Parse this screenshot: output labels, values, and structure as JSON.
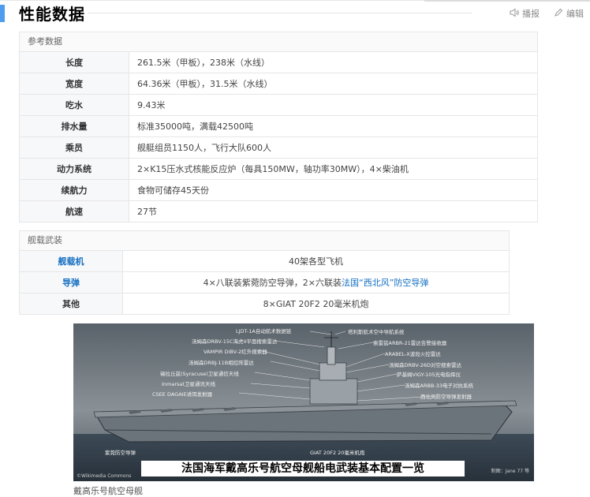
{
  "header": {
    "title": "性能数据",
    "actions": {
      "report": "播报",
      "edit": "编辑"
    }
  },
  "specs": {
    "caption": "参考数据",
    "rows": [
      {
        "key": "长度",
        "value": "261.5米（甲板），238米（水线）"
      },
      {
        "key": "宽度",
        "value": "64.36米（甲板），31.5米（水线）"
      },
      {
        "key": "吃水",
        "value": "9.43米"
      },
      {
        "key": "排水量",
        "value": "标准35000吨，满载42500吨"
      },
      {
        "key": "乘员",
        "value": "舰艇组员1150人，飞行大队600人"
      },
      {
        "key": "动力系统",
        "value": "2×K15压水式核能反应炉（每具150MW，轴功率30MW），4×柴油机"
      },
      {
        "key": "续航力",
        "value": "食物可储存45天份"
      },
      {
        "key": "航速",
        "value": "27节"
      }
    ]
  },
  "weapons": {
    "caption": "舰载武装",
    "rows": [
      {
        "key": "舰载机",
        "value": "40架各型飞机"
      },
      {
        "key": "导弹",
        "value_prefix": "4×八联装紫菀防空导弹，2×六联装",
        "value_link": "法国“西北风”防空导弹",
        "value_suffix": ""
      },
      {
        "key": "其他",
        "value": "8×GIAT 20F2 20毫米机炮"
      }
    ]
  },
  "figure": {
    "banner": "法国海军戴高乐号航空母舰船电武装基本配置一览",
    "labels": [
      "LJDT-1A自动航术数据链",
      "塔利斯航术空中导航系统",
      "汤姆森DRBV-15C海虎II平面搜索雷达",
      "索雷兹ARBR-21雷达告警接收器",
      "VAMPIR DIBV-2红外搜索器",
      "ARABEL-X波段火控雷达",
      "汤姆森DRBJ-11B相控阵雷达",
      "汤姆森DRBV-26D对空搜索雷达",
      "锡拉丘兹(Syracuse)卫星通信天线",
      "萨基姆VIGY-105光电指挥仪",
      "Inmarsat卫星通讯天线",
      "汤姆森ARBB-33电子对抗系统",
      "CSEE DAGAIE诱饵发射器",
      "西北风防空导弹发射器",
      "紫菀防空导弹",
      "GIAT 20F2 20毫米机炮"
    ],
    "credit_left": "©Wikimedia Commons",
    "credit_right": "制图：Jane 77 等"
  },
  "caption_below": "戴高乐号航空母舰"
}
